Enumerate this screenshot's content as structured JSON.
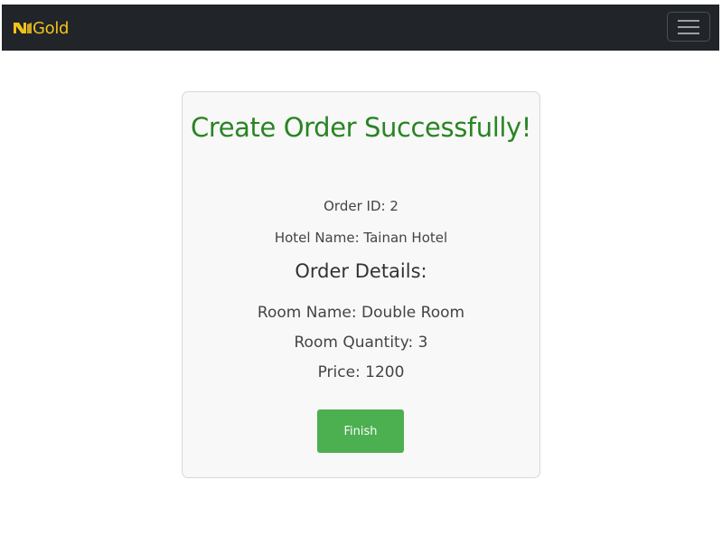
{
  "navbar": {
    "brand_text": "Gold",
    "brand_color": "#f2c21b",
    "logo_icon": "gold-logo-icon",
    "menu_icon": "hamburger-menu-icon"
  },
  "card": {
    "title": "Create Order Successfully!",
    "title_color": "#2a8424",
    "order_id": "Order ID: 2",
    "hotel_name": "Hotel Name: Tainan Hotel",
    "details_heading": "Order Details:",
    "room_name": "Room Name: Double Room",
    "room_quantity": "Room Quantity: 3",
    "price": "Price: 1200",
    "finish_label": "Finish",
    "finish_color": "#4caf50"
  }
}
